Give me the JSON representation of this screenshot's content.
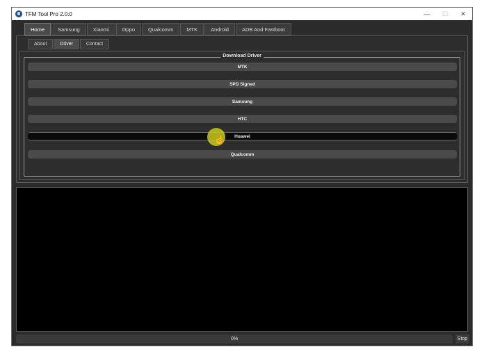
{
  "window": {
    "title": "TFM Tool Pro 2.0.0",
    "controls": {
      "minimize": "—",
      "maximize": "☐",
      "close": "✕"
    }
  },
  "main_tabs": [
    "Home",
    "Samsung",
    "Xiaomi",
    "Oppo",
    "Qualcomm",
    "MTK",
    "Android",
    "ADB And Fastboot"
  ],
  "active_main_tab": "Home",
  "sub_tabs": [
    "About",
    "Driver",
    "Contact"
  ],
  "active_sub_tab": "Driver",
  "download_driver": {
    "legend": "Download Driver",
    "buttons": [
      "MTK",
      "SPD Signed",
      "Samsung",
      "HTC",
      "Huawei",
      "Qualcomm"
    ],
    "hovered": "Huawei"
  },
  "progress": {
    "text": "0%",
    "value": 0
  },
  "stop_label": "Stop",
  "colors": {
    "window_bg": "#2b2b2b",
    "button_bg": "#4a4a4a",
    "log_bg": "#000000",
    "cursor_highlight": "#c8c81e"
  }
}
